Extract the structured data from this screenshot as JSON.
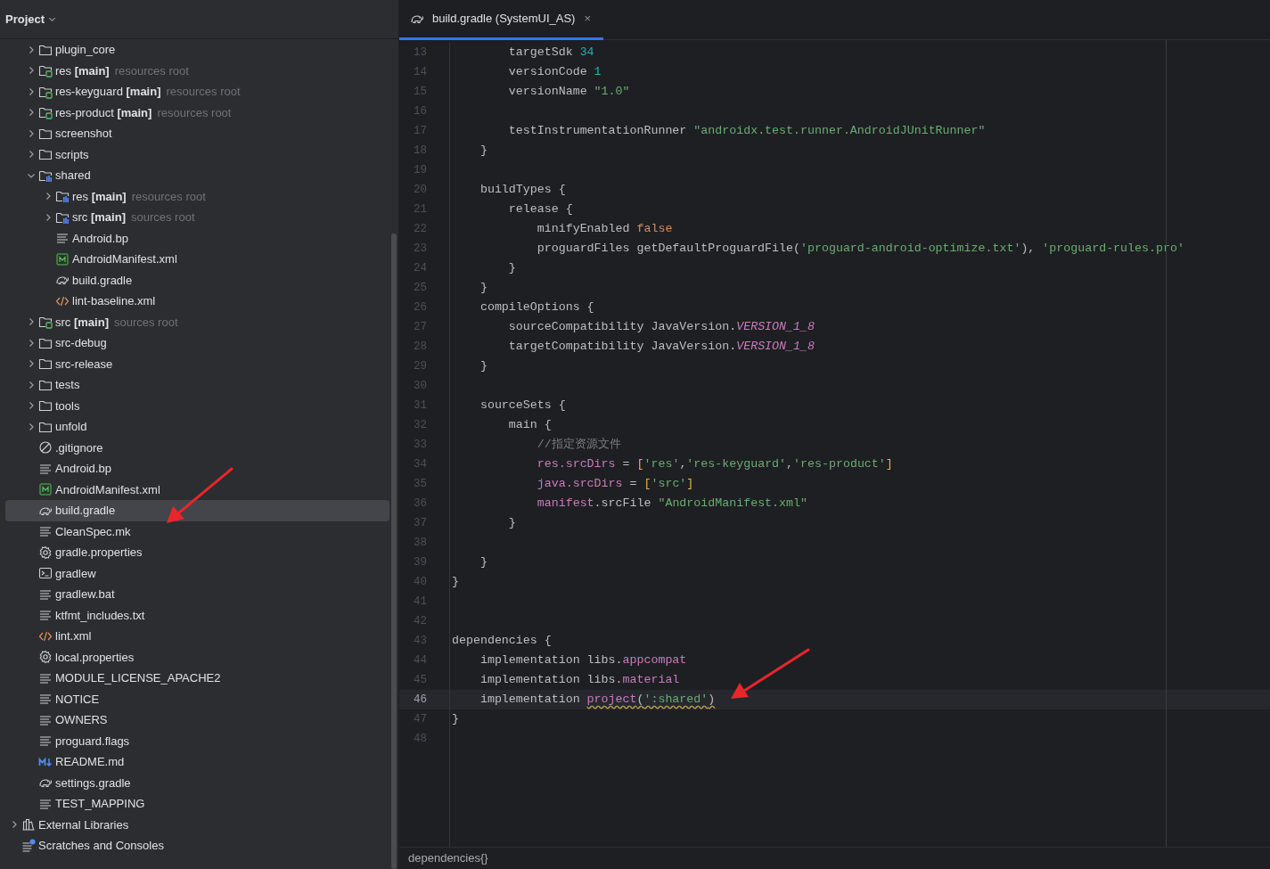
{
  "panel": {
    "title": "Project"
  },
  "module_items": [
    {
      "label": "plugin_core",
      "kind": "folder",
      "expanded": false,
      "selected": false
    },
    {
      "label": "res",
      "suffix": "[main]",
      "hint": "resources root",
      "kind": "source_root",
      "expanded": false,
      "selected": false
    },
    {
      "label": "res-keyguard",
      "suffix": "[main]",
      "hint": "resources root",
      "kind": "source_root",
      "expanded": false,
      "selected": false
    },
    {
      "label": "res-product",
      "suffix": "[main]",
      "hint": "resources root",
      "kind": "source_root",
      "expanded": false,
      "selected": false
    },
    {
      "label": "screenshot",
      "kind": "folder",
      "expanded": false,
      "selected": false
    },
    {
      "label": "scripts",
      "kind": "folder",
      "expanded": false,
      "selected": false
    },
    {
      "label": "shared",
      "kind": "module",
      "expanded": true,
      "selected": false,
      "children": [
        {
          "label": "res",
          "suffix": "[main]",
          "hint": "resources root",
          "kind": "module_root",
          "expanded": false,
          "selected": false
        },
        {
          "label": "src",
          "suffix": "[main]",
          "hint": "sources root",
          "kind": "module_root",
          "expanded": false,
          "selected": false
        },
        {
          "label": "Android.bp",
          "kind": "text",
          "selected": false
        },
        {
          "label": "AndroidManifest.xml",
          "kind": "manifest",
          "selected": false
        },
        {
          "label": "build.gradle",
          "kind": "gradle",
          "selected": false
        },
        {
          "label": "lint-baseline.xml",
          "kind": "xml",
          "selected": false
        }
      ]
    },
    {
      "label": "src",
      "suffix": "[main]",
      "hint": "sources root",
      "kind": "source_root",
      "expanded": false,
      "selected": false
    },
    {
      "label": "src-debug",
      "kind": "folder",
      "expanded": false,
      "selected": false
    },
    {
      "label": "src-release",
      "kind": "folder",
      "expanded": false,
      "selected": false
    },
    {
      "label": "tests",
      "kind": "folder",
      "expanded": false,
      "selected": false
    },
    {
      "label": "tools",
      "kind": "folder",
      "expanded": false,
      "selected": false
    },
    {
      "label": "unfold",
      "kind": "folder",
      "expanded": false,
      "selected": false
    },
    {
      "label": ".gitignore",
      "kind": "ignore",
      "selected": false
    },
    {
      "label": "Android.bp",
      "kind": "text",
      "selected": false
    },
    {
      "label": "AndroidManifest.xml",
      "kind": "manifest",
      "selected": false
    },
    {
      "label": "build.gradle",
      "kind": "gradle",
      "selected": true
    },
    {
      "label": "CleanSpec.mk",
      "kind": "text",
      "selected": false
    },
    {
      "label": "gradle.properties",
      "kind": "properties",
      "selected": false
    },
    {
      "label": "gradlew",
      "kind": "script",
      "selected": false
    },
    {
      "label": "gradlew.bat",
      "kind": "text",
      "selected": false
    },
    {
      "label": "ktfmt_includes.txt",
      "kind": "text",
      "selected": false
    },
    {
      "label": "lint.xml",
      "kind": "xml",
      "selected": false
    },
    {
      "label": "local.properties",
      "kind": "properties",
      "selected": false
    },
    {
      "label": "MODULE_LICENSE_APACHE2",
      "kind": "text",
      "selected": false
    },
    {
      "label": "NOTICE",
      "kind": "text",
      "selected": false
    },
    {
      "label": "OWNERS",
      "kind": "text",
      "selected": false
    },
    {
      "label": "proguard.flags",
      "kind": "text",
      "selected": false
    },
    {
      "label": "README.md",
      "kind": "markdown",
      "selected": false
    },
    {
      "label": "settings.gradle",
      "kind": "gradle",
      "selected": false
    },
    {
      "label": "TEST_MAPPING",
      "kind": "text",
      "selected": false
    }
  ],
  "root_items": [
    {
      "label": "External Libraries",
      "kind": "library",
      "expanded": false,
      "selected": false
    },
    {
      "label": "Scratches and Consoles",
      "kind": "scratches",
      "selected": false
    }
  ],
  "editor": {
    "tabs": [
      {
        "title": "build.gradle (SystemUI_AS)",
        "close": "×",
        "selected": true
      }
    ],
    "lines": [
      {
        "number": "13",
        "current": false,
        "tokens": [
          {
            "text": "        targetSdk ",
            "kind": "plain"
          },
          {
            "text": "34",
            "kind": "num"
          }
        ]
      },
      {
        "number": "14",
        "current": false,
        "tokens": [
          {
            "text": "        versionCode ",
            "kind": "plain"
          },
          {
            "text": "1",
            "kind": "num"
          }
        ]
      },
      {
        "number": "15",
        "current": false,
        "tokens": [
          {
            "text": "        versionName ",
            "kind": "plain"
          },
          {
            "text": "\"1.0\"",
            "kind": "str"
          }
        ]
      },
      {
        "number": "16",
        "current": false
      },
      {
        "number": "17",
        "current": false,
        "tokens": [
          {
            "text": "        testInstrumentationRunner ",
            "kind": "plain"
          },
          {
            "text": "\"androidx.test.runner.AndroidJUnitRunner\"",
            "kind": "str"
          }
        ]
      },
      {
        "number": "18",
        "current": false,
        "tokens": [
          {
            "text": "    }",
            "kind": "plain"
          }
        ]
      },
      {
        "number": "19",
        "current": false
      },
      {
        "number": "20",
        "current": false,
        "tokens": [
          {
            "text": "    buildTypes {",
            "kind": "plain"
          }
        ]
      },
      {
        "number": "21",
        "current": false,
        "tokens": [
          {
            "text": "        release {",
            "kind": "plain"
          }
        ]
      },
      {
        "number": "22",
        "current": false,
        "tokens": [
          {
            "text": "            minifyEnabled ",
            "kind": "plain"
          },
          {
            "text": "false",
            "kind": "kw"
          }
        ]
      },
      {
        "number": "23",
        "current": false,
        "tokens": [
          {
            "text": "            proguardFiles getDefaultProguardFile(",
            "kind": "plain"
          },
          {
            "text": "'proguard-android-optimize.txt'",
            "kind": "str"
          },
          {
            "text": "), ",
            "kind": "plain"
          },
          {
            "text": "'proguard-rules.pro'",
            "kind": "str"
          }
        ]
      },
      {
        "number": "24",
        "current": false,
        "tokens": [
          {
            "text": "        }",
            "kind": "plain"
          }
        ]
      },
      {
        "number": "25",
        "current": false,
        "tokens": [
          {
            "text": "    }",
            "kind": "plain"
          }
        ]
      },
      {
        "number": "26",
        "current": false,
        "tokens": [
          {
            "text": "    compileOptions {",
            "kind": "plain"
          }
        ]
      },
      {
        "number": "27",
        "current": false,
        "tokens": [
          {
            "text": "        sourceCompatibility JavaVersion.",
            "kind": "plain"
          },
          {
            "text": "VERSION_1_8",
            "kind": "field"
          }
        ]
      },
      {
        "number": "28",
        "current": false,
        "tokens": [
          {
            "text": "        targetCompatibility JavaVersion.",
            "kind": "plain"
          },
          {
            "text": "VERSION_1_8",
            "kind": "field"
          }
        ]
      },
      {
        "number": "29",
        "current": false,
        "tokens": [
          {
            "text": "    }",
            "kind": "plain"
          }
        ]
      },
      {
        "number": "30",
        "current": false
      },
      {
        "number": "31",
        "current": false,
        "tokens": [
          {
            "text": "    sourceSets {",
            "kind": "plain"
          }
        ]
      },
      {
        "number": "32",
        "current": false,
        "tokens": [
          {
            "text": "        main {",
            "kind": "plain"
          }
        ]
      },
      {
        "number": "33",
        "current": false,
        "tokens": [
          {
            "text": "            //指定资源文件",
            "kind": "comment"
          }
        ]
      },
      {
        "number": "34",
        "current": false,
        "tokens": [
          {
            "text": "            res.srcDirs",
            "kind": "prop"
          },
          {
            "text": " = ",
            "kind": "plain"
          },
          {
            "text": "[",
            "kind": "bracket"
          },
          {
            "text": "'res'",
            "kind": "str"
          },
          {
            "text": ",",
            "kind": "plain"
          },
          {
            "text": "'res-keyguard'",
            "kind": "str"
          },
          {
            "text": ",",
            "kind": "plain"
          },
          {
            "text": "'res-product'",
            "kind": "str"
          },
          {
            "text": "]",
            "kind": "bracket"
          }
        ]
      },
      {
        "number": "35",
        "current": false,
        "tokens": [
          {
            "text": "            java.srcDirs",
            "kind": "prop"
          },
          {
            "text": " = ",
            "kind": "plain"
          },
          {
            "text": "[",
            "kind": "bracket"
          },
          {
            "text": "'src'",
            "kind": "str"
          },
          {
            "text": "]",
            "kind": "bracket"
          }
        ]
      },
      {
        "number": "36",
        "current": false,
        "tokens": [
          {
            "text": "            manifest",
            "kind": "prop"
          },
          {
            "text": ".srcFile ",
            "kind": "plain"
          },
          {
            "text": "\"AndroidManifest.xml\"",
            "kind": "str"
          }
        ]
      },
      {
        "number": "37",
        "current": false,
        "tokens": [
          {
            "text": "        }",
            "kind": "plain"
          }
        ]
      },
      {
        "number": "38",
        "current": false
      },
      {
        "number": "39",
        "current": false,
        "tokens": [
          {
            "text": "    }",
            "kind": "plain"
          }
        ]
      },
      {
        "number": "40",
        "current": false,
        "tokens": [
          {
            "text": "}",
            "kind": "plain"
          }
        ]
      },
      {
        "number": "41",
        "current": false
      },
      {
        "number": "42",
        "current": false
      },
      {
        "number": "43",
        "current": false,
        "tokens": [
          {
            "text": "dependencies {",
            "kind": "plain"
          }
        ]
      },
      {
        "number": "44",
        "current": false,
        "tokens": [
          {
            "text": "    implementation libs.",
            "kind": "plain"
          },
          {
            "text": "appcompat",
            "kind": "prop"
          }
        ]
      },
      {
        "number": "45",
        "current": false,
        "tokens": [
          {
            "text": "    implementation libs.",
            "kind": "plain"
          },
          {
            "text": "material",
            "kind": "prop"
          }
        ]
      },
      {
        "number": "46",
        "current": true,
        "tokens": [
          {
            "text": "    implementation ",
            "kind": "plain"
          },
          {
            "text": "project",
            "kind": "prop_warn"
          },
          {
            "text": "(",
            "kind": "plain_warn"
          },
          {
            "text": "':shared'",
            "kind": "str_warn"
          },
          {
            "text": ")",
            "kind": "plain_warn"
          }
        ]
      },
      {
        "number": "47",
        "current": false,
        "tokens": [
          {
            "text": "}",
            "kind": "plain"
          }
        ]
      },
      {
        "number": "48",
        "current": false
      }
    ],
    "breadcrumb": "dependencies{}"
  }
}
